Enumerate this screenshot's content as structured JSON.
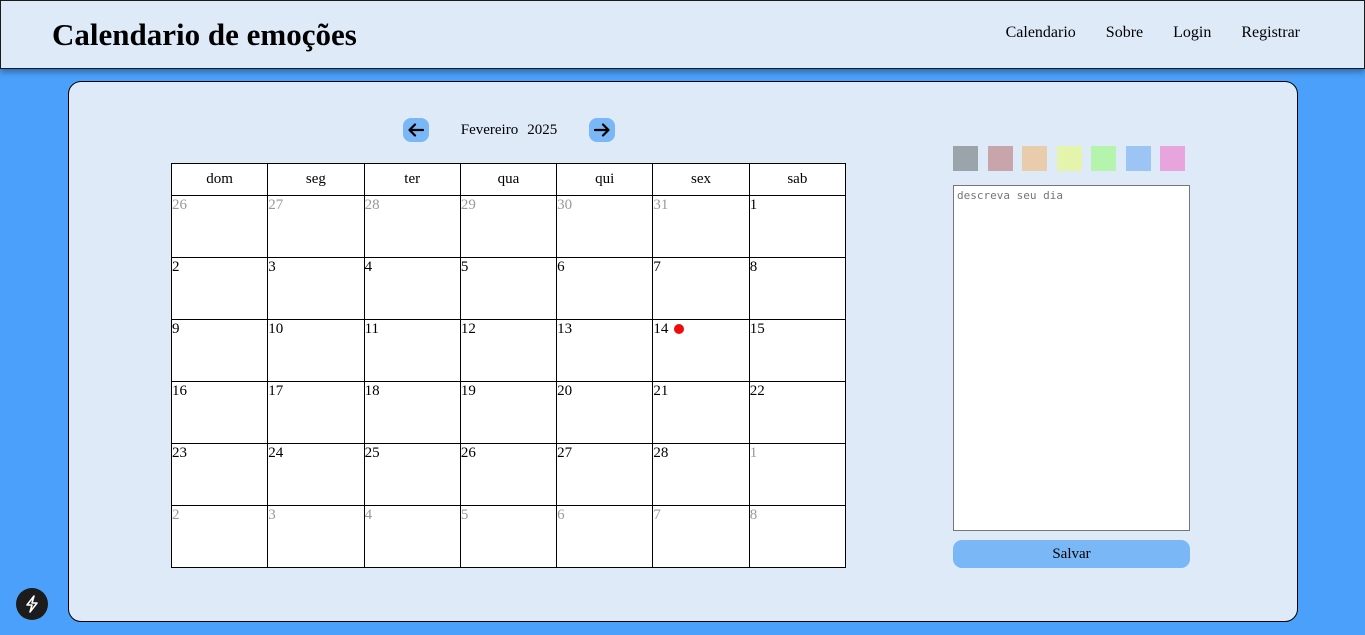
{
  "header": {
    "brand": "Calendario de emoções",
    "nav": [
      "Calendario",
      "Sobre",
      "Login",
      "Registrar"
    ]
  },
  "calendar": {
    "month": "Fevereiro",
    "year": "2025",
    "weekdays": [
      "dom",
      "seg",
      "ter",
      "qua",
      "qui",
      "sex",
      "sab"
    ],
    "weeks": [
      [
        {
          "d": "26",
          "o": true
        },
        {
          "d": "27",
          "o": true
        },
        {
          "d": "28",
          "o": true
        },
        {
          "d": "29",
          "o": true
        },
        {
          "d": "30",
          "o": true
        },
        {
          "d": "31",
          "o": true
        },
        {
          "d": "1",
          "o": false
        }
      ],
      [
        {
          "d": "2",
          "o": false
        },
        {
          "d": "3",
          "o": false
        },
        {
          "d": "4",
          "o": false
        },
        {
          "d": "5",
          "o": false
        },
        {
          "d": "6",
          "o": false
        },
        {
          "d": "7",
          "o": false
        },
        {
          "d": "8",
          "o": false
        }
      ],
      [
        {
          "d": "9",
          "o": false
        },
        {
          "d": "10",
          "o": false
        },
        {
          "d": "11",
          "o": false
        },
        {
          "d": "12",
          "o": false
        },
        {
          "d": "13",
          "o": false
        },
        {
          "d": "14",
          "o": false,
          "marked": true
        },
        {
          "d": "15",
          "o": false
        }
      ],
      [
        {
          "d": "16",
          "o": false
        },
        {
          "d": "17",
          "o": false
        },
        {
          "d": "18",
          "o": false
        },
        {
          "d": "19",
          "o": false
        },
        {
          "d": "20",
          "o": false
        },
        {
          "d": "21",
          "o": false
        },
        {
          "d": "22",
          "o": false
        }
      ],
      [
        {
          "d": "23",
          "o": false
        },
        {
          "d": "24",
          "o": false
        },
        {
          "d": "25",
          "o": false
        },
        {
          "d": "26",
          "o": false
        },
        {
          "d": "27",
          "o": false
        },
        {
          "d": "28",
          "o": false
        },
        {
          "d": "1",
          "o": true
        }
      ],
      [
        {
          "d": "2",
          "o": true
        },
        {
          "d": "3",
          "o": true
        },
        {
          "d": "4",
          "o": true
        },
        {
          "d": "5",
          "o": true
        },
        {
          "d": "6",
          "o": true
        },
        {
          "d": "7",
          "o": true
        },
        {
          "d": "8",
          "o": true
        }
      ]
    ],
    "marker_color": "#f00a0a"
  },
  "emotion_colors": [
    "#9ba4ab",
    "#c8a4ab",
    "#e8ccac",
    "#e4f4ac",
    "#b4f4ac",
    "#9cc4f4",
    "#e8a4dc"
  ],
  "journal": {
    "placeholder": "descreva seu dia",
    "save_label": "Salvar"
  },
  "icons": {
    "prev": "arrow-left-icon",
    "next": "arrow-right-icon",
    "dev": "lightning-icon"
  }
}
